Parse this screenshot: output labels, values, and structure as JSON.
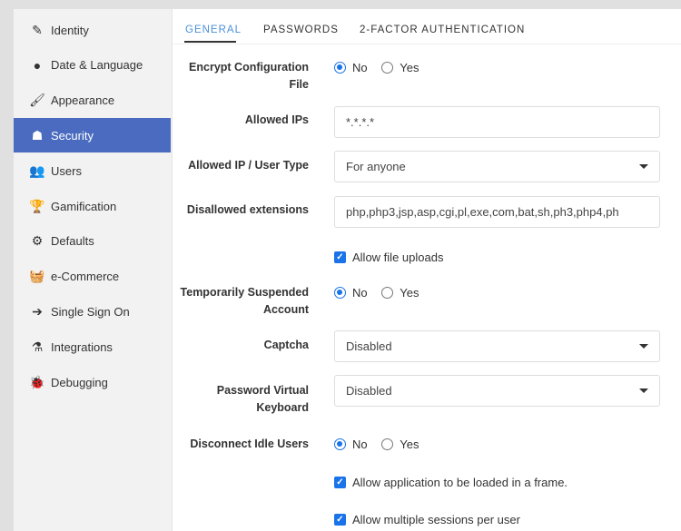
{
  "sidebar": {
    "items": [
      {
        "label": "Identity",
        "icon": "edit-icon",
        "glyph": "✎"
      },
      {
        "label": "Date & Language",
        "icon": "globe-icon",
        "glyph": "●"
      },
      {
        "label": "Appearance",
        "icon": "paintbrush-icon",
        "glyph": "🖌"
      },
      {
        "label": "Security",
        "icon": "user-secret-icon",
        "glyph": "☗"
      },
      {
        "label": "Users",
        "icon": "users-icon",
        "glyph": "👥"
      },
      {
        "label": "Gamification",
        "icon": "trophy-icon",
        "glyph": "🏆"
      },
      {
        "label": "Defaults",
        "icon": "cogs-icon",
        "glyph": "⚙"
      },
      {
        "label": "e-Commerce",
        "icon": "basket-icon",
        "glyph": "🧺"
      },
      {
        "label": "Single Sign On",
        "icon": "sign-in-icon",
        "glyph": "➔"
      },
      {
        "label": "Integrations",
        "icon": "flask-icon",
        "glyph": "⚗"
      },
      {
        "label": "Debugging",
        "icon": "bug-icon",
        "glyph": "🐞"
      }
    ],
    "active": "Security"
  },
  "tabs": [
    "GENERAL",
    "PASSWORDS",
    "2-FACTOR AUTHENTICATION"
  ],
  "form": {
    "encrypt": {
      "label": "Encrypt Configuration File",
      "no": "No",
      "yes": "Yes",
      "value": "No"
    },
    "allowed_ips": {
      "label": "Allowed IPs",
      "value": "*.*.*.*"
    },
    "ip_user_type": {
      "label": "Allowed IP / User Type",
      "value": "For anyone"
    },
    "disallowed_ext": {
      "label": "Disallowed extensions",
      "value": "php,php3,jsp,asp,cgi,pl,exe,com,bat,sh,ph3,php4,ph"
    },
    "allow_uploads": {
      "label": "Allow file uploads",
      "checked": true
    },
    "suspended": {
      "label": "Temporarily Suspended Account",
      "no": "No",
      "yes": "Yes",
      "value": "No"
    },
    "captcha": {
      "label": "Captcha",
      "value": "Disabled"
    },
    "vkeyboard": {
      "label": "Password Virtual Keyboard",
      "value": "Disabled"
    },
    "idle": {
      "label": "Disconnect Idle Users",
      "no": "No",
      "yes": "Yes",
      "value": "No"
    },
    "frame": {
      "label": "Allow application to be loaded in a frame.",
      "checked": true
    },
    "multi": {
      "label": "Allow multiple sessions per user",
      "checked": true
    }
  }
}
